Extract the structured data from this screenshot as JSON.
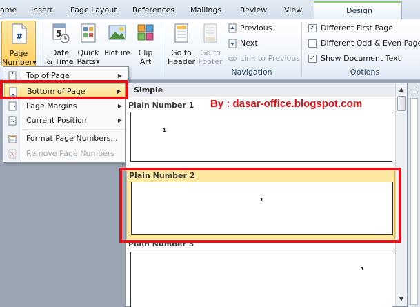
{
  "tabs": [
    "ome",
    "Insert",
    "Page Layout",
    "References",
    "Mailings",
    "Review",
    "View",
    "Design"
  ],
  "ribbon": {
    "page_number": {
      "line1": "Page",
      "line2": "Number",
      "caret": "▾"
    },
    "date_time": {
      "line1": "Date",
      "line2": "& Time"
    },
    "quick_parts": {
      "line1": "Quick",
      "line2": "Parts",
      "caret": "▾"
    },
    "picture": {
      "label": "Picture"
    },
    "clip_art": {
      "line1": "Clip",
      "line2": "Art"
    },
    "goto_header": {
      "line1": "Go to",
      "line2": "Header"
    },
    "goto_footer": {
      "line1": "Go to",
      "line2": "Footer"
    },
    "previous": "Previous",
    "next": "Next",
    "link_previous": "Link to Previous",
    "navigation_label": "Navigation",
    "options": {
      "different_first_page": {
        "label": "Different First Page",
        "checked": true
      },
      "different_odd_even": {
        "label": "Different Odd & Even Pages",
        "checked": false
      },
      "show_document_text": {
        "label": "Show Document Text",
        "checked": true
      }
    },
    "options_label": "Options",
    "check_mark": "✓"
  },
  "menu": {
    "items": [
      {
        "label": "Top of Page",
        "arrow": "▶"
      },
      {
        "label": "Bottom of Page",
        "arrow": "▶"
      },
      {
        "label": "Page Margins",
        "arrow": "▶"
      },
      {
        "label": "Current Position",
        "arrow": "▶"
      },
      {
        "label": "Format Page Numbers..."
      },
      {
        "label": "Remove Page Numbers"
      }
    ]
  },
  "gallery": {
    "header": "Simple",
    "items": [
      {
        "title": "Plain Number 1",
        "number": "1"
      },
      {
        "title": "Plain Number 2",
        "number": "1"
      },
      {
        "title": "Plain Number 3",
        "number": "1"
      }
    ]
  },
  "watermark": "By : dasar-office.blogspot.com",
  "ruler": {
    "tab_marker": "⊥"
  },
  "scroll": {
    "up": "▲",
    "down": "▼"
  },
  "colors": {
    "accent_red": "#e2121b",
    "highlight": "#ffdf83",
    "ribbon_blue": "#dfe9f5"
  }
}
